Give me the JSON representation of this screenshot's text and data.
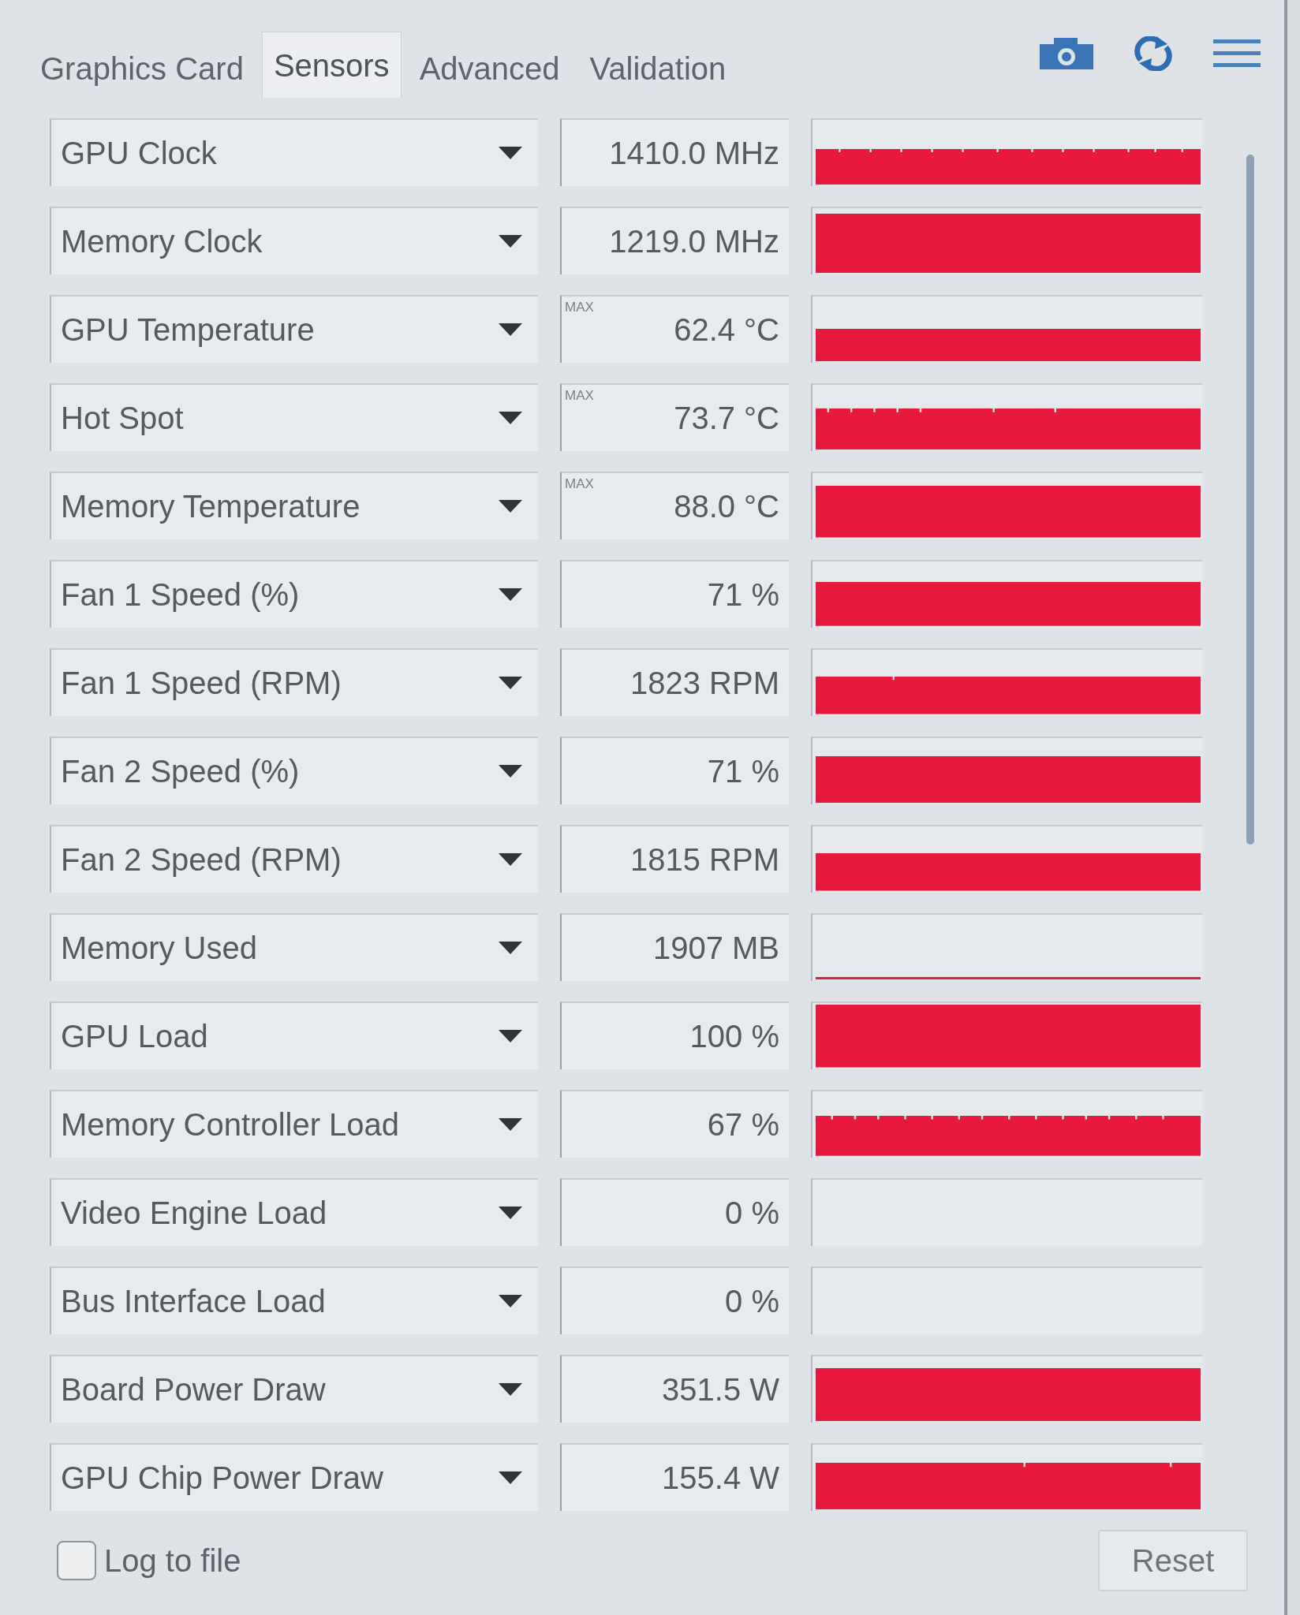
{
  "tabs": [
    {
      "label": "Graphics Card",
      "selected": false
    },
    {
      "label": "Sensors",
      "selected": true
    },
    {
      "label": "Advanced",
      "selected": false
    },
    {
      "label": "Validation",
      "selected": false
    }
  ],
  "sensors": [
    {
      "name": "GPU Clock",
      "value": "1410.0 MHz"
    },
    {
      "name": "Memory Clock",
      "value": "1219.0 MHz"
    },
    {
      "name": "GPU Temperature",
      "mode": "MAX",
      "value": "62.4 °C"
    },
    {
      "name": "Hot Spot",
      "mode": "MAX",
      "value": "73.7 °C"
    },
    {
      "name": "Memory Temperature",
      "mode": "MAX",
      "value": "88.0 °C"
    },
    {
      "name": "Fan 1 Speed (%)",
      "value": "71 %"
    },
    {
      "name": "Fan 1 Speed (RPM)",
      "value": "1823 RPM"
    },
    {
      "name": "Fan 2 Speed (%)",
      "value": "71 %"
    },
    {
      "name": "Fan 2 Speed (RPM)",
      "value": "1815 RPM"
    },
    {
      "name": "Memory Used",
      "value": "1907 MB"
    },
    {
      "name": "GPU Load",
      "value": "100 %"
    },
    {
      "name": "Memory Controller Load",
      "value": "67 %"
    },
    {
      "name": "Video Engine Load",
      "value": "0 %"
    },
    {
      "name": "Bus Interface Load",
      "value": "0 %"
    },
    {
      "name": "Board Power Draw",
      "value": "351.5 W"
    },
    {
      "name": "GPU Chip Power Draw",
      "value": "155.4 W"
    }
  ],
  "log_to_file": {
    "label": "Log to file",
    "checked": false
  },
  "reset_button": {
    "label": "Reset"
  }
}
